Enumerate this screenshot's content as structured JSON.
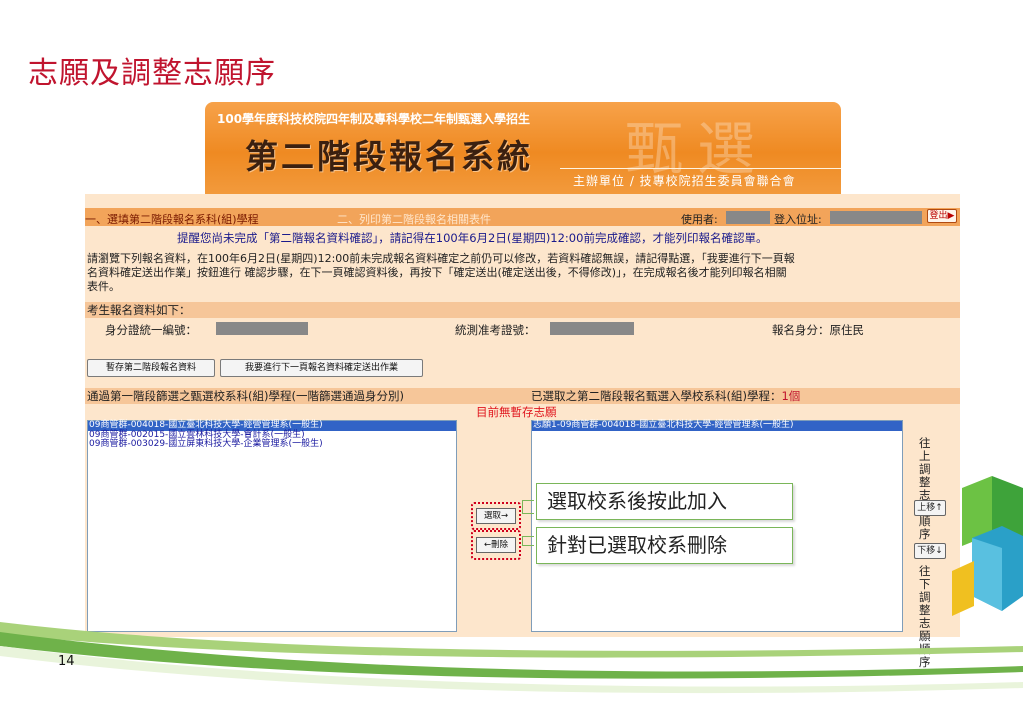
{
  "slide": {
    "title": "志願及調整志願序",
    "page_number": "14"
  },
  "banner": {
    "top_line": "100學年度科技校院四年制及專科學校二年制甄選入學招生",
    "title": "第二階段報名系統",
    "watermark": "甄選",
    "organizer": "主辦單位 / 技專校院招生委員會聯合會"
  },
  "nav": {
    "step1": "一、選填第二階段報名系科(組)學程",
    "step2": "二、列印第二階段報名相關表件",
    "user_label": "使用者:",
    "ip_label": "登入位址:",
    "logout": "登出"
  },
  "reminder": "提醒您尚未完成「第二階報名資料確認」，請記得在100年6月2日(星期四)12:00前完成確認，才能列印報名確認單。",
  "instructions": [
    "請瀏覽下列報名資料，在100年6月2日(星期四)12:00前未完成報名資料確定之前仍可以修改，若資料確認無誤，請記得點選，「我要進行下一頁報",
    "名資料確定送出作業」按鈕進行 確認步驟，在下一頁確認資料後，再按下「確定送出(確定送出後，不得修改)」，在完成報名後才能列印報名相關",
    "表件。"
  ],
  "applicant": {
    "section_title": "考生報名資料如下：",
    "id_label": "身分證統一編號：",
    "exam_label": "統測准考證號：",
    "identity_label": "報名身分：原住民"
  },
  "buttons": {
    "save_draft": "暫存第二階段報名資料",
    "next_page": "我要進行下一頁報名資料確定送出作業",
    "select": "選取→",
    "delete": "←刪除",
    "move_up": "上移↑",
    "move_down": "下移↓"
  },
  "left_column": {
    "header": "通過第一階段篩選之甄選校系科(組)學程(一階篩選通過身分別)",
    "items": [
      "09商管群-004018-國立臺北科技大學-經營管理系(一般生)",
      "09商管群-002015-國立雲林科技大學-會計系(一般生)",
      "09商管群-003029-國立屏東科技大學-企業管理系(一般生)"
    ],
    "selected_index": 0
  },
  "right_column": {
    "header": "已選取之第二階段報名甄選入學校系科(組)學程：",
    "count": "1個",
    "items": [
      "志願1-09商管群-004018-國立臺北科技大學-經營管理系(一般生)"
    ],
    "selected_index": 0
  },
  "no_preference_note": "目前無暫存志願",
  "callouts": {
    "select": "選取校系後按此加入",
    "delete": "針對已選取校系刪除"
  },
  "move_up_text": "往上調整志願順序",
  "move_down_text": "往下調整志願順序",
  "colors": {
    "title_red": "#c0142e",
    "banner_orange": "#ef8a22",
    "panel_bg": "#fde6cc",
    "header_band": "#f6c699",
    "selection_blue": "#3163c6",
    "callout_green": "#7ab659"
  }
}
